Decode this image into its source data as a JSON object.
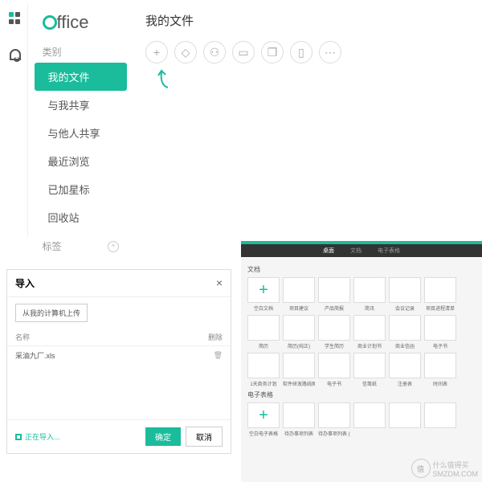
{
  "brand": "ffice",
  "sidebar": {
    "cat_label": "类别",
    "items": [
      "我的文件",
      "与我共享",
      "与他人共享",
      "最近浏览",
      "已加星标",
      "回收站"
    ],
    "tag_label": "标签"
  },
  "main": {
    "title": "我的文件"
  },
  "dialog": {
    "title": "导入",
    "upload_btn": "从我的计算机上传",
    "col_name": "名称",
    "col_del": "删除",
    "file": "采油九厂.xls",
    "loading": "正在导入...",
    "ok": "确定",
    "cancel": "取消"
  },
  "templates": {
    "tabs": [
      "桌面",
      "文档",
      "电子表格"
    ],
    "sec1": "文档",
    "row1": [
      "空白文档",
      "项目建议",
      "产品简报",
      "简讯",
      "会议记录",
      "项目进程清单"
    ],
    "row2": [
      "简历",
      "简历(纯正)",
      "学生简历",
      "商业计划书",
      "商业信函",
      "电子书"
    ],
    "row3": [
      "1天商务计划",
      "软件研发路线图",
      "电子书",
      "信笺纸",
      "注册表",
      "时间表"
    ],
    "sec2": "电子表格",
    "row4": [
      "空白电子表格",
      "待办事项列表",
      "待办事项列表 (专业)",
      "",
      "",
      ""
    ]
  },
  "watermark": {
    "text": "什么值得买",
    "site": "SMZDM.COM",
    "badge": "值"
  }
}
